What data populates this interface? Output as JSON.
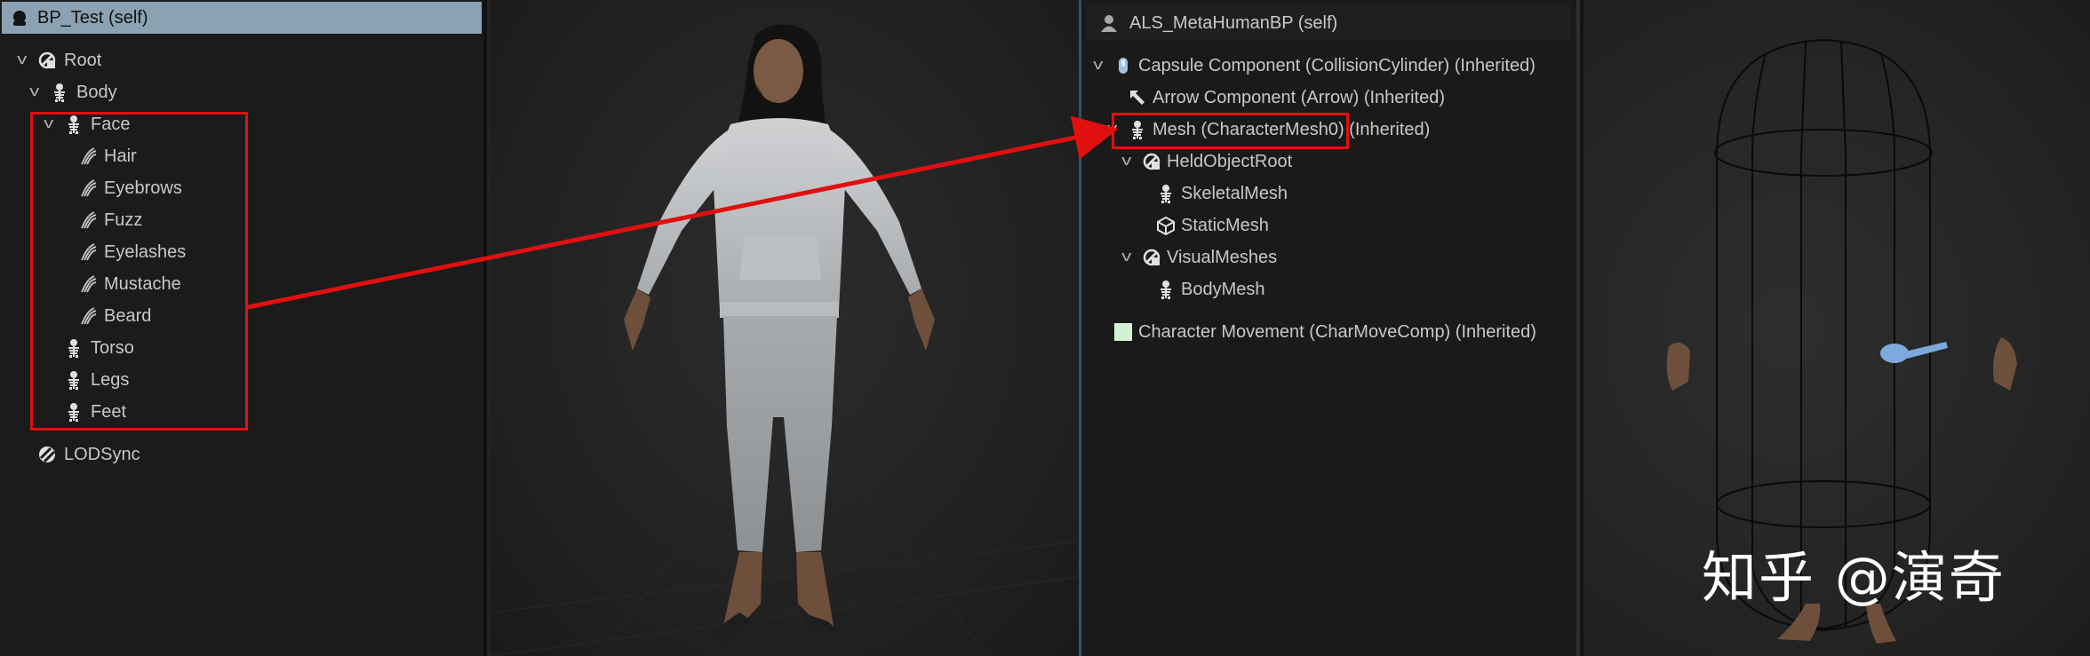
{
  "left_panel": {
    "header": "BP_Test (self)",
    "tree": [
      {
        "label": "Root",
        "icon": "scene-component-icon",
        "depth": 0,
        "expanded": true
      },
      {
        "label": "Body",
        "icon": "skeletal-mesh-icon",
        "depth": 1,
        "expanded": true
      },
      {
        "label": "Face",
        "icon": "skeletal-mesh-icon",
        "depth": 2,
        "expanded": true
      },
      {
        "label": "Hair",
        "icon": "groom-icon",
        "depth": 3
      },
      {
        "label": "Eyebrows",
        "icon": "groom-icon",
        "depth": 3
      },
      {
        "label": "Fuzz",
        "icon": "groom-icon",
        "depth": 3
      },
      {
        "label": "Eyelashes",
        "icon": "groom-icon",
        "depth": 3
      },
      {
        "label": "Mustache",
        "icon": "groom-icon",
        "depth": 3
      },
      {
        "label": "Beard",
        "icon": "groom-icon",
        "depth": 3
      },
      {
        "label": "Torso",
        "icon": "skeletal-mesh-icon",
        "depth": 2
      },
      {
        "label": "Legs",
        "icon": "skeletal-mesh-icon",
        "depth": 2
      },
      {
        "label": "Feet",
        "icon": "skeletal-mesh-icon",
        "depth": 2
      },
      {
        "label": "LODSync",
        "icon": "lodsync-icon",
        "depth": 1
      }
    ]
  },
  "right_panel": {
    "header": "ALS_MetaHumanBP (self)",
    "tree": [
      {
        "label": "Capsule Component (CollisionCylinder) (Inherited)",
        "icon": "capsule-icon",
        "depth": 0,
        "expanded": true
      },
      {
        "label": "Arrow Component (Arrow) (Inherited)",
        "icon": "arrow-component-icon",
        "depth": 1
      },
      {
        "label": "Mesh (CharacterMesh0) (Inherited)",
        "icon": "skeletal-mesh-icon",
        "depth": 1,
        "expanded": true
      },
      {
        "label": "HeldObjectRoot",
        "icon": "scene-component-icon",
        "depth": 2,
        "expanded": true
      },
      {
        "label": "SkeletalMesh",
        "icon": "skeletal-mesh-icon",
        "depth": 3
      },
      {
        "label": "StaticMesh",
        "icon": "static-mesh-icon",
        "depth": 3
      },
      {
        "label": "VisualMeshes",
        "icon": "scene-component-icon",
        "depth": 2,
        "expanded": true
      },
      {
        "label": "BodyMesh",
        "icon": "skeletal-mesh-icon",
        "depth": 3
      },
      {
        "label": "Character Movement (CharMoveComp) (Inherited)",
        "icon": "movement-component-icon",
        "depth": 0
      }
    ]
  },
  "watermark": "知乎 @演奇",
  "colors": {
    "header_bg": "#8aa2b1",
    "highlight_red": "#e01010",
    "panel_bg": "#1b1b1b",
    "text": "#c8c8c8"
  }
}
